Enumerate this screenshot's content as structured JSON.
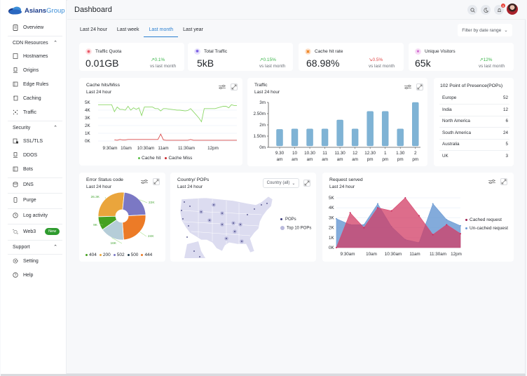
{
  "app": {
    "brand_name_part1": "Asians",
    "brand_name_part2": "Group",
    "page_title": "Dashboard"
  },
  "sidebar": {
    "overview": "Overview",
    "cdn_resources": {
      "label": "CDN Resources",
      "items": [
        "Hostnames",
        "Origins",
        "Edge Rules",
        "Caching",
        "Traffic"
      ]
    },
    "security": {
      "label": "Security",
      "items": [
        "SSL/TLS",
        "DDOS",
        "Bots"
      ]
    },
    "dns": "DNS",
    "purge": "Purge",
    "log_activity": "Log activity",
    "web3": "Web3",
    "web3_badge": "New",
    "support": {
      "label": "Support",
      "items": [
        "Setting",
        "Help"
      ]
    }
  },
  "header": {
    "notification_count": "8",
    "icons": [
      "search-icon",
      "moon-icon",
      "bell-icon"
    ]
  },
  "tabs": [
    {
      "label": "Last 24 hour",
      "active": false
    },
    {
      "label": "Last week",
      "active": false
    },
    {
      "label": "Last month",
      "active": true
    },
    {
      "label": "Last year",
      "active": false
    }
  ],
  "filter": {
    "label": "Filter by date range"
  },
  "stats": [
    {
      "title": "Traffic Quota",
      "value": "0.01GB",
      "change": "0.1%",
      "direction": "up",
      "vs": "vs last month",
      "icon_color": "#e8485a"
    },
    {
      "title": "Total Traffic",
      "value": "5kB",
      "change": "0.15%",
      "direction": "up",
      "vs": "vs last month",
      "icon_color": "#6a4ce0"
    },
    {
      "title": "Cache hit rate",
      "value": "68.98%",
      "change": "0.5%",
      "direction": "down",
      "vs": "vs last month",
      "icon_color": "#f08a2c"
    },
    {
      "title": "Unique Visitors",
      "value": "65k",
      "change": "12%",
      "direction": "up",
      "vs": "vs last month",
      "icon_color": "#c84ec8"
    }
  ],
  "panels": {
    "cache": {
      "title": "Cache hits/Miss",
      "subtitle": "Last 24 hour"
    },
    "traffic": {
      "title": "Traffic",
      "subtitle": "Last 24 hour"
    },
    "pops": {
      "title": "102 Point of Presence(POPs)",
      "rows": [
        {
          "region": "Europe",
          "count": "52"
        },
        {
          "region": "India",
          "count": "12"
        },
        {
          "region": "North America",
          "count": "6"
        },
        {
          "region": "South America",
          "count": "24"
        },
        {
          "region": "Australia",
          "count": "5"
        },
        {
          "region": "UK",
          "count": "3"
        }
      ]
    },
    "errors": {
      "title": "Error Status code",
      "subtitle": "Last 24 hour"
    },
    "country": {
      "title": "Country/ POPs",
      "subtitle": "Last 24 hour",
      "select_value": "Country (all)",
      "legend_pops": "POPs",
      "legend_top10": "Top 10 POPs"
    },
    "requests": {
      "title": "Request served",
      "subtitle": "Last 24 hour"
    }
  },
  "chart_data": [
    {
      "id": "cache",
      "type": "line",
      "title": "Cache hits/Miss",
      "x_ticks": [
        "9:30am",
        "10am",
        "10:30am",
        "11am",
        "11:30am",
        "12pm"
      ],
      "y_ticks": [
        "0K",
        "1K",
        "2K",
        "3K",
        "4K",
        "5K"
      ],
      "ylim": [
        0,
        5000
      ],
      "legend": "bottom",
      "series": [
        {
          "name": "Cache hit",
          "color": "#8ed86a",
          "values": [
            4700,
            4700,
            4700,
            4700,
            4700,
            4700,
            3800,
            4400,
            4100,
            4100,
            4000,
            4500,
            4000,
            4300,
            4100,
            4300,
            3300,
            4400,
            4400,
            4400,
            4400,
            4200,
            4200,
            3900,
            4200,
            4200,
            4150,
            4100,
            4050,
            4000,
            4000,
            3950,
            3900,
            3950,
            4200,
            3800,
            3400,
            3000,
            2500,
            4200,
            4200,
            4200,
            4200,
            4200,
            4300,
            4400,
            4500,
            4500,
            4300,
            4700,
            4600,
            4600
          ]
        },
        {
          "name": "Cache Miss",
          "color": "#d94a4a",
          "values": [
            50,
            null,
            null,
            null,
            null,
            null,
            150,
            100,
            200,
            150,
            150,
            200,
            200,
            200,
            200,
            200,
            200,
            200,
            200,
            200,
            200,
            200,
            200,
            900,
            150,
            100,
            100,
            100,
            100,
            100,
            100,
            100,
            100,
            100,
            200,
            100,
            100,
            100,
            100,
            100,
            100,
            100,
            100,
            100,
            100,
            100,
            100,
            100,
            100,
            100,
            100,
            100
          ]
        }
      ]
    },
    {
      "id": "traffic",
      "type": "bar",
      "title": "Traffic",
      "categories": [
        "9.30 am",
        "10 am",
        "10.30 am",
        "11 am",
        "11.30 am",
        "12 am",
        "12.30 pm",
        "1 pm",
        "1.30 pm",
        "2 pm"
      ],
      "values": [
        1.8,
        1.82,
        1.82,
        1.82,
        2.22,
        1.82,
        2.6,
        2.6,
        1.82,
        3.0
      ],
      "y_ticks": [
        "0m",
        "1.50m",
        "2m",
        "2.50m",
        "3m"
      ],
      "ylim": [
        0,
        3
      ],
      "color": "#7fb3d5"
    },
    {
      "id": "errors",
      "type": "pie",
      "title": "Error Status code",
      "slices": [
        {
          "label": "200",
          "value": 26.3,
          "display": "26.3K",
          "color": "#eaa53c"
        },
        {
          "label": "502",
          "value": 22,
          "display": "22K",
          "color": "#7b78c4"
        },
        {
          "label": "444",
          "value": 24,
          "display": "24K",
          "color": "#ec7b27"
        },
        {
          "label": "500",
          "value": 16,
          "display": "16K",
          "color": "#b5cdd8"
        },
        {
          "label": "404",
          "value": 9,
          "display": "9K",
          "color": "#45a121"
        }
      ],
      "legend": [
        {
          "label": "404",
          "color": "#45a121"
        },
        {
          "label": "200",
          "color": "#eaa53c"
        },
        {
          "label": "502",
          "color": "#7b78c4"
        },
        {
          "label": "500",
          "color": "#1f3a4a"
        },
        {
          "label": "444",
          "color": "#ec7b27"
        }
      ]
    },
    {
      "id": "requests",
      "type": "area",
      "title": "Request served",
      "x_ticks": [
        "9:30am",
        "10am",
        "10:30am",
        "11am",
        "11:30am",
        "12pm"
      ],
      "y_ticks": [
        "0K",
        "1K",
        "2K",
        "3K",
        "4K",
        "5K"
      ],
      "ylim": [
        0,
        5000
      ],
      "legend": "right",
      "series": [
        {
          "name": "Cached request",
          "color": "#d9476e",
          "values": [
            0,
            3500,
            2000,
            4000,
            3700,
            5000,
            3200,
            1300,
            2300,
            1400
          ]
        },
        {
          "name": "Un-cached request",
          "color": "#6d9bd3",
          "values": [
            2900,
            2300,
            2300,
            4400,
            2100,
            800,
            500,
            4400,
            2800,
            2200
          ]
        }
      ]
    }
  ]
}
